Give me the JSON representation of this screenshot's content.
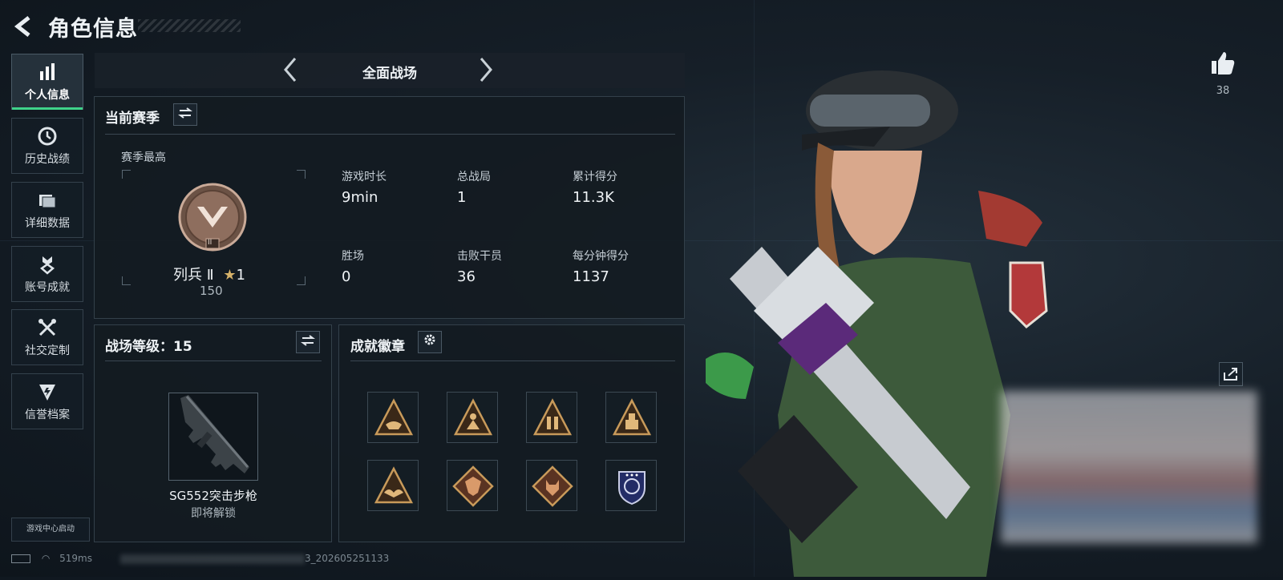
{
  "header": {
    "title": "角色信息"
  },
  "sidebar": {
    "items": [
      {
        "label": "个人信息",
        "icon": "bar-chart-icon",
        "active": true
      },
      {
        "label": "历史战绩",
        "icon": "clock-icon"
      },
      {
        "label": "详细数据",
        "icon": "folder-icon"
      },
      {
        "label": "账号成就",
        "icon": "achievement-icon"
      },
      {
        "label": "社交定制",
        "icon": "tools-icon"
      },
      {
        "label": "信誉档案",
        "icon": "shield-icon"
      }
    ],
    "game_center": "游戏中心启动"
  },
  "mode": {
    "label": "全面战场"
  },
  "season": {
    "title": "当前赛季",
    "best_label": "赛季最高",
    "rank_name": "列兵 Ⅱ",
    "rank_stars": "1",
    "rank_points": "150",
    "rank_badge_numeral": "II",
    "stats": [
      {
        "label": "游戏时长",
        "value": "9min"
      },
      {
        "label": "总战局",
        "value": "1"
      },
      {
        "label": "累计得分",
        "value": "11.3K"
      },
      {
        "label": "胜场",
        "value": "0"
      },
      {
        "label": "击败干员",
        "value": "36"
      },
      {
        "label": "每分钟得分",
        "value": "1137"
      }
    ]
  },
  "battlefield": {
    "title": "战场等级：15",
    "weapon_name": "SG552突击步枪",
    "weapon_status": "即将解锁"
  },
  "badges": {
    "title": "成就徽章",
    "items": [
      "hand-triangle-badge",
      "figure-triangle-badge",
      "soldiers-triangle-badge",
      "building-triangle-badge",
      "wings-triangle-badge",
      "dragon-diamond-badge",
      "wolf-diamond-badge",
      "police-shield-badge"
    ]
  },
  "profile": {
    "likes": "38"
  },
  "status_bar": {
    "ping": "519ms",
    "build": "3_202605251133"
  },
  "colors": {
    "accent": "#3fd28a",
    "badge_gold": "#c89a5a",
    "panel_bg": "#131b22"
  }
}
